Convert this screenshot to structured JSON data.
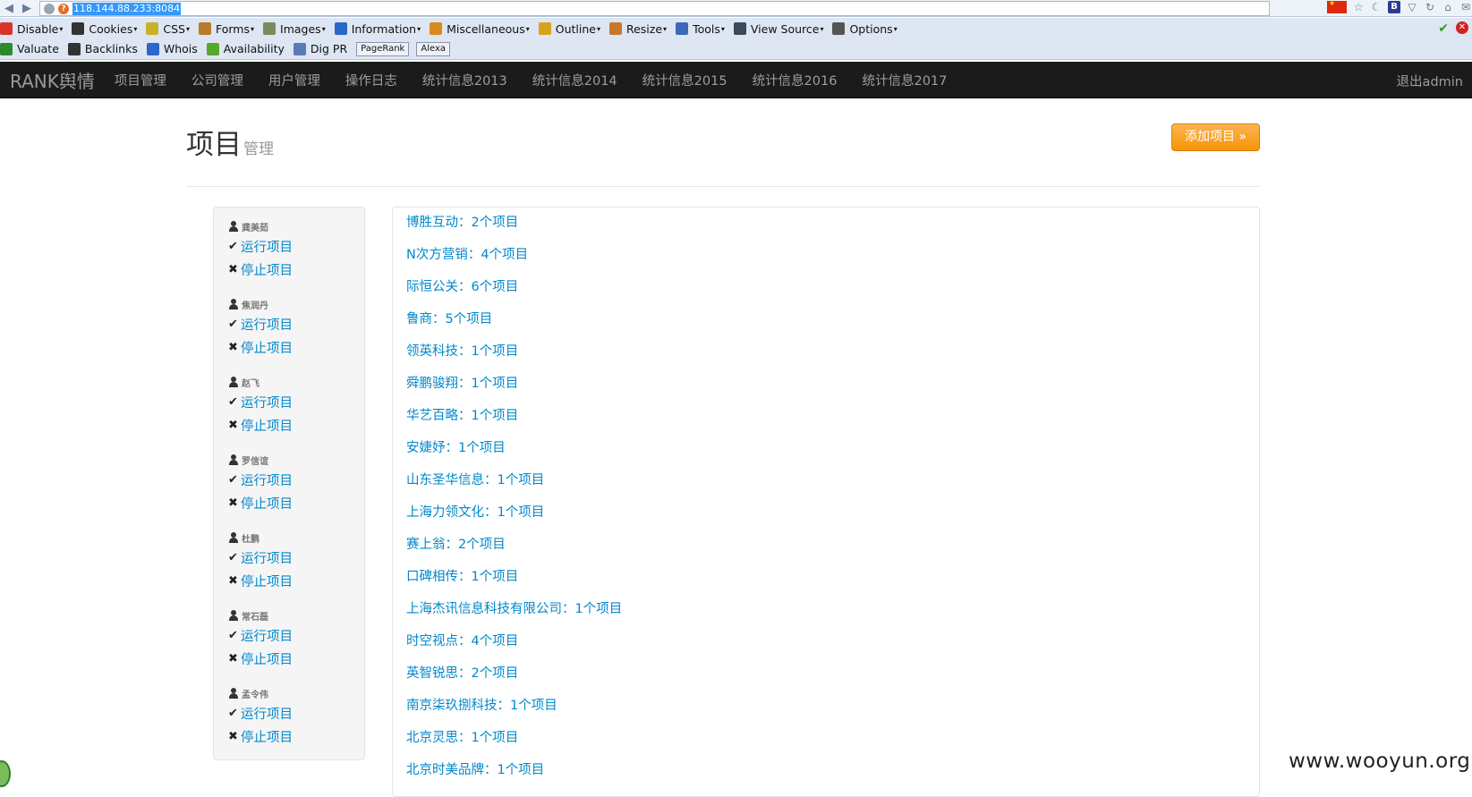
{
  "browser": {
    "url": "118.144.88.233:8084",
    "toolbar1": [
      {
        "label": "Disable",
        "icon": "no-entry-icon",
        "color": "#d9342b"
      },
      {
        "label": "Cookies",
        "icon": "person-icon",
        "color": "#333333"
      },
      {
        "label": "CSS",
        "icon": "pencil-icon",
        "color": "#c8b22a"
      },
      {
        "label": "Forms",
        "icon": "clipboard-icon",
        "color": "#b97a2a"
      },
      {
        "label": "Images",
        "icon": "image-icon",
        "color": "#7b8a5a"
      },
      {
        "label": "Information",
        "icon": "info-icon",
        "color": "#2a67c8"
      },
      {
        "label": "Miscellaneous",
        "icon": "notebook-icon",
        "color": "#d88a1c"
      },
      {
        "label": "Outline",
        "icon": "pencil-icon",
        "color": "#d8a21c"
      },
      {
        "label": "Resize",
        "icon": "ruler-icon",
        "color": "#c8782a"
      },
      {
        "label": "Tools",
        "icon": "tools-icon",
        "color": "#3a6ab8"
      },
      {
        "label": "View Source",
        "icon": "monitor-icon",
        "color": "#3a4a5a"
      },
      {
        "label": "Options",
        "icon": "options-icon",
        "color": "#555555"
      }
    ],
    "toolbar2": [
      {
        "label": "Valuate",
        "icon": "dollar-icon",
        "color": "#2c8a2c"
      },
      {
        "label": "Backlinks",
        "icon": "arrows-icon",
        "color": "#333333"
      },
      {
        "label": "Whois",
        "icon": "globe-icon",
        "color": "#2a67c8"
      },
      {
        "label": "Availability",
        "icon": "search-icon",
        "color": "#58a82a"
      },
      {
        "label": "Dig PR",
        "icon": "network-icon",
        "color": "#5a7ab8"
      }
    ],
    "pills": [
      "PageRank",
      "Alexa"
    ]
  },
  "navbar": {
    "brand": "RANK舆情",
    "links": [
      "项目管理",
      "公司管理",
      "用户管理",
      "操作日志",
      "统计信息2013",
      "统计信息2014",
      "统计信息2015",
      "统计信息2016",
      "统计信息2017"
    ],
    "logout": "退出admin"
  },
  "header": {
    "title": "项目",
    "subtitle": "管理",
    "add_button": "添加项目 »"
  },
  "sidebar": {
    "users": [
      {
        "name": "龚美茹",
        "run": "运行项目",
        "stop": "停止项目"
      },
      {
        "name": "焦润丹",
        "run": "运行项目",
        "stop": "停止项目"
      },
      {
        "name": "赵飞",
        "run": "运行项目",
        "stop": "停止项目"
      },
      {
        "name": "罗信谊",
        "run": "运行项目",
        "stop": "停止项目"
      },
      {
        "name": "杜鹏",
        "run": "运行项目",
        "stop": "停止项目"
      },
      {
        "name": "常石磊",
        "run": "运行项目",
        "stop": "停止项目"
      },
      {
        "name": "孟令伟",
        "run": "运行项目",
        "stop": "停止项目"
      }
    ]
  },
  "companies": [
    "博胜互动：2个项目",
    "N次方营销：4个项目",
    "际恒公关：6个项目",
    "鲁商：5个项目",
    "领英科技：1个项目",
    "舜鹏骏翔：1个项目",
    "华艺百略：1个项目",
    "安婕妤：1个项目",
    "山东圣华信息：1个项目",
    "上海力领文化：1个项目",
    "赛上翁：2个项目",
    "口碑相传：1个项目",
    "上海杰讯信息科技有限公司：1个项目",
    "时空视点：4个项目",
    "英智锐思：2个项目",
    "南京柒玖捌科技：1个项目",
    "北京灵思：1个项目",
    "北京时美品牌：1个项目"
  ],
  "watermark": "www.wooyun.org",
  "colors": {
    "link": "#0088cc",
    "navbar": "#1b1b1b",
    "accent": "#f89406"
  }
}
